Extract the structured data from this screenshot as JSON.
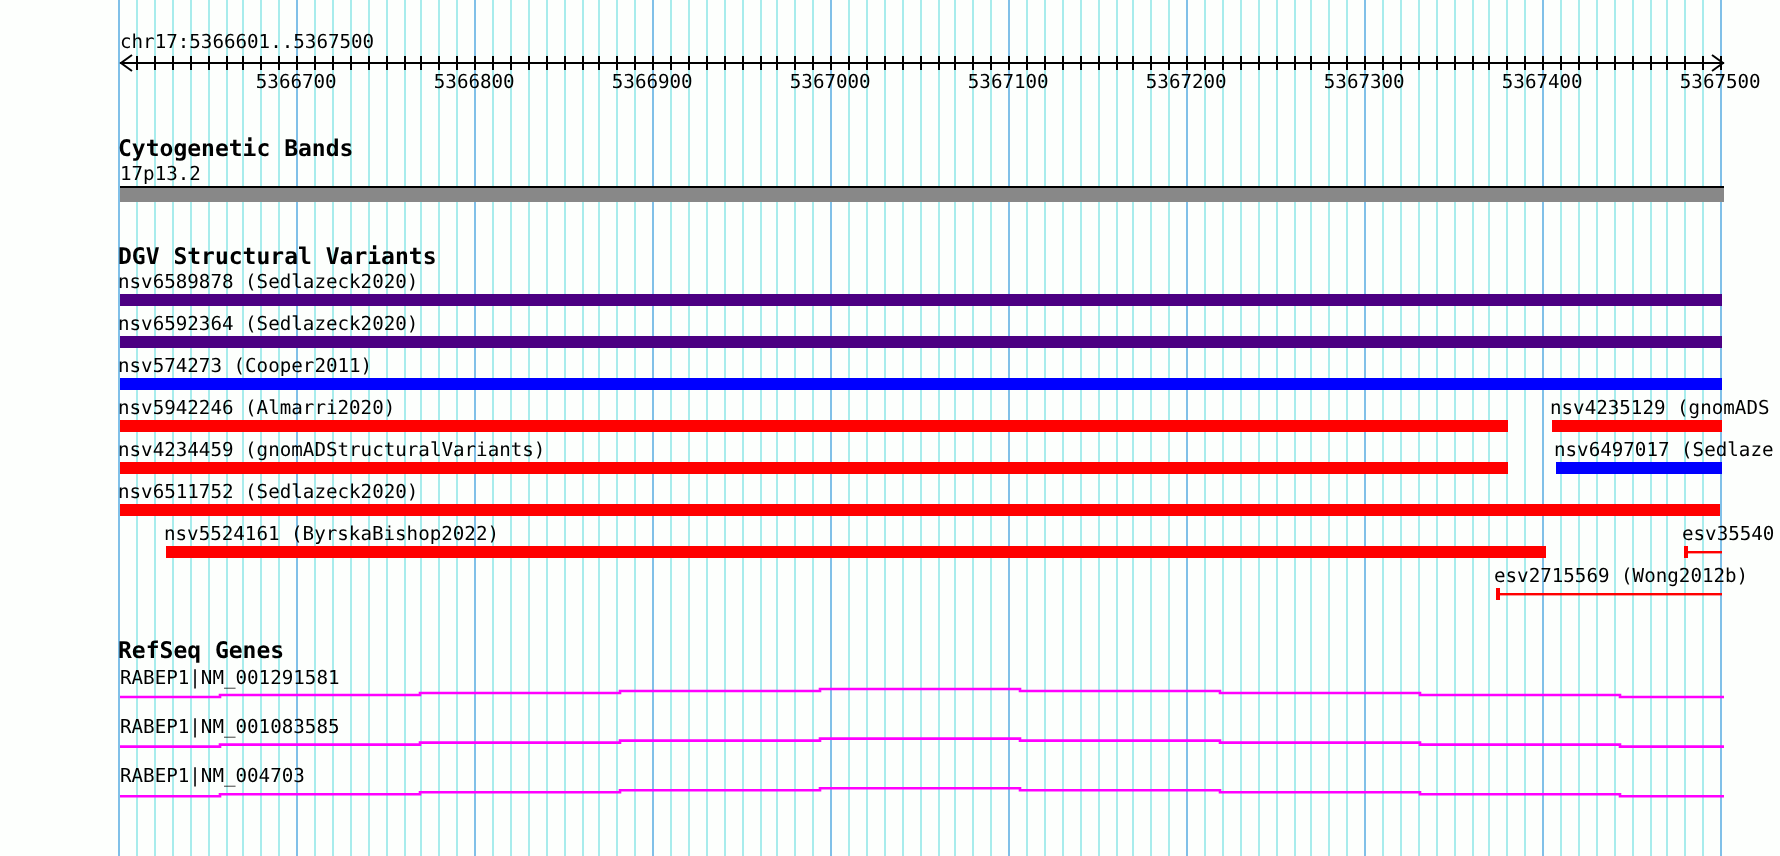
{
  "view": {
    "position": "chr17:5366601..5367500"
  },
  "ruler": {
    "ticks": [
      "5366700",
      "5366800",
      "5366900",
      "5367000",
      "5367100",
      "5367200",
      "5367300",
      "5367400",
      "5367500"
    ]
  },
  "cytogenetic_bands": {
    "title": "Cytogenetic Bands",
    "band": "17p13.2"
  },
  "dgv": {
    "title": "DGV Structural Variants",
    "rows": [
      {
        "features": [
          {
            "label": "nsv6589878 (Sedlazeck2020)",
            "kind": "bar",
            "color": "#4b0082"
          }
        ]
      },
      {
        "features": [
          {
            "label": "nsv6592364 (Sedlazeck2020)",
            "kind": "bar",
            "color": "#4b0082"
          }
        ]
      },
      {
        "features": [
          {
            "label": "nsv574273 (Cooper2011)",
            "kind": "bar",
            "color": "#0000ff"
          }
        ]
      },
      {
        "features": [
          {
            "label": "nsv5942246 (Almarri2020)",
            "kind": "bar",
            "color": "#ff0000"
          },
          {
            "label": "nsv4235129 (gnomADS",
            "kind": "bar",
            "color": "#ff0000"
          }
        ]
      },
      {
        "features": [
          {
            "label": "nsv4234459 (gnomADStructuralVariants)",
            "kind": "bar",
            "color": "#ff0000"
          },
          {
            "label": "nsv6497017 (Sedlaze",
            "kind": "bar",
            "color": "#0000ff"
          }
        ]
      },
      {
        "features": [
          {
            "label": "nsv6511752 (Sedlazeck2020)",
            "kind": "bar",
            "color": "#ff0000"
          }
        ]
      },
      {
        "features": [
          {
            "label": "nsv5524161 (ByrskaBishop2022)",
            "kind": "bar",
            "color": "#ff0000"
          },
          {
            "label": "esv35540",
            "kind": "line",
            "color": "#ff0000"
          }
        ]
      },
      {
        "features": [
          {
            "label": "esv2715569 (Wong2012b)",
            "kind": "line",
            "color": "#ff0000"
          }
        ]
      }
    ]
  },
  "refseq": {
    "title": "RefSeq Genes",
    "genes": [
      {
        "label": "RABEP1|NM_001291581"
      },
      {
        "label": "RABEP1|NM_001083585"
      },
      {
        "label": "RABEP1|NM_004703"
      }
    ]
  }
}
